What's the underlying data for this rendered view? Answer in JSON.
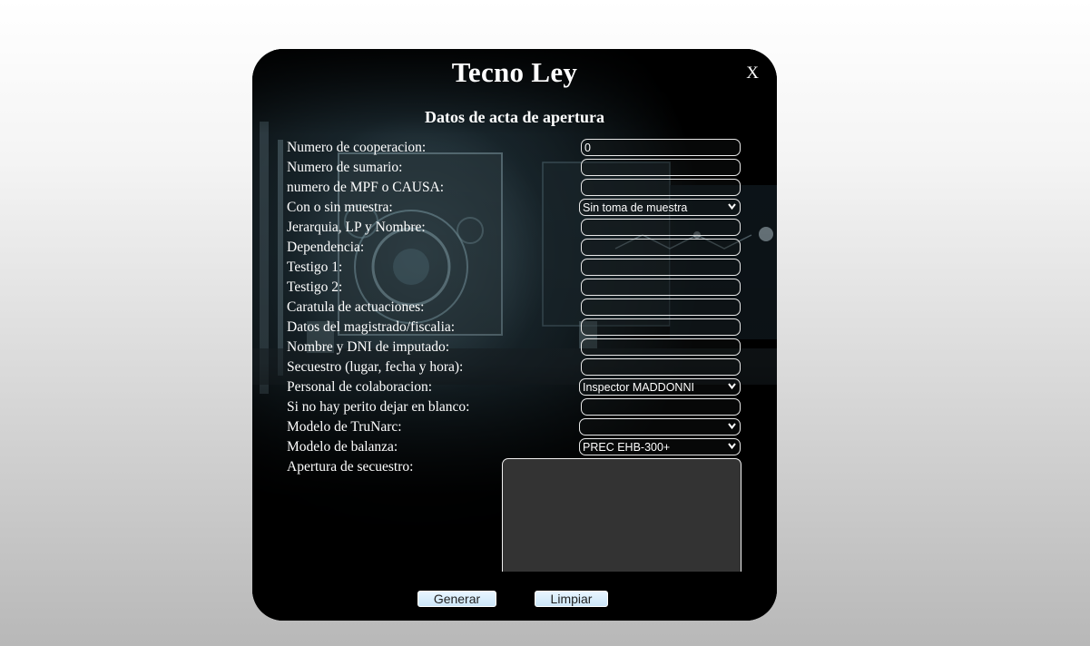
{
  "modal": {
    "title": "Tecno Ley",
    "close_label": "X",
    "subtitle": "Datos de acta de apertura"
  },
  "fields": [
    {
      "label": "Numero de cooperacion:",
      "type": "input",
      "value": "0"
    },
    {
      "label": "Numero de sumario:",
      "type": "input",
      "value": ""
    },
    {
      "label": "numero de MPF o CAUSA:",
      "type": "input",
      "value": ""
    },
    {
      "label": "Con o sin muestra:",
      "type": "select",
      "value": "Sin toma de muestra"
    },
    {
      "label": "Jerarquia, LP y Nombre:",
      "type": "input",
      "value": ""
    },
    {
      "label": "Dependencia:",
      "type": "input",
      "value": ""
    },
    {
      "label": "Testigo 1:",
      "type": "input",
      "value": ""
    },
    {
      "label": "Testigo 2:",
      "type": "input",
      "value": ""
    },
    {
      "label": "Caratula de actuaciones:",
      "type": "input",
      "value": ""
    },
    {
      "label": "Datos del magistrado/fiscalia:",
      "type": "input",
      "value": ""
    },
    {
      "label": "Nombre y DNI de imputado:",
      "type": "input",
      "value": ""
    },
    {
      "label": "Secuestro (lugar, fecha y hora):",
      "type": "input",
      "value": ""
    },
    {
      "label": "Personal de colaboracion:",
      "type": "select",
      "value": "Inspector MADDONNI"
    },
    {
      "label": "Si no hay perito dejar en blanco:",
      "type": "input",
      "value": ""
    },
    {
      "label": "Modelo de TruNarc:",
      "type": "select",
      "value": ""
    },
    {
      "label": "Modelo de balanza:",
      "type": "select",
      "value": "PREC EHB-300+"
    }
  ],
  "textarea": {
    "label": "Apertura de secuestro:",
    "value": ""
  },
  "buttons": {
    "generate": "Generar",
    "clear": "Limpiar"
  },
  "colors": {
    "page_background_top": "#ffffff",
    "page_background_bottom": "#b8b8b8",
    "modal_background": "#050607",
    "button_fill": "#cbe6f8",
    "textarea_fill": "#333333"
  }
}
